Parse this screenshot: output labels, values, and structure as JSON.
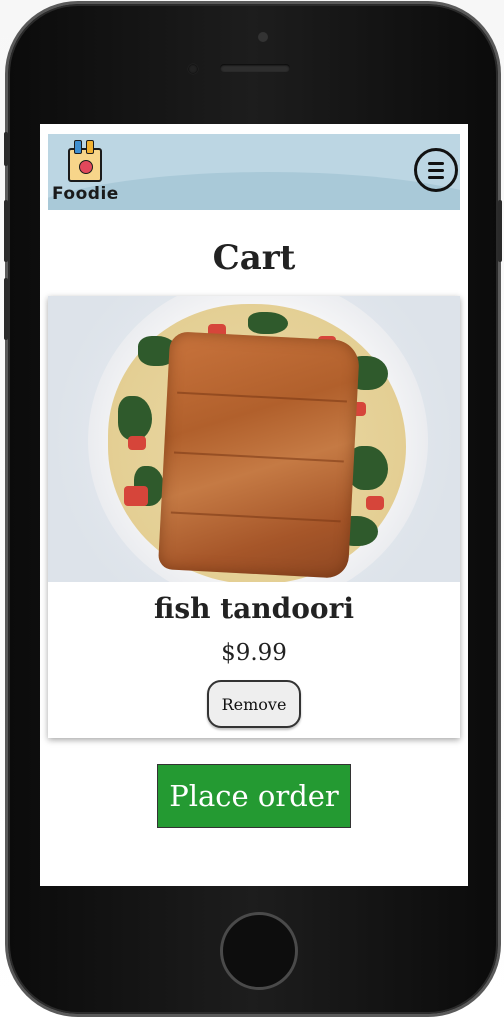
{
  "header": {
    "logo_text": "Foodie",
    "menu_icon": "hamburger-menu-icon"
  },
  "page": {
    "title": "Cart"
  },
  "cart": {
    "items": [
      {
        "name": "fish tandoori",
        "price": "$9.99",
        "remove_label": "Remove"
      }
    ]
  },
  "actions": {
    "place_order_label": "Place order"
  },
  "colors": {
    "header_bg": "#bcd6e3",
    "place_order_bg": "#249a32",
    "text": "#222222"
  }
}
